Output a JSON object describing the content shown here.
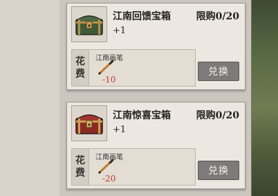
{
  "items": [
    {
      "name": "江南回馈宝箱",
      "qty": "+1",
      "limit": "限购0/20",
      "chest_color": "#3f5a3a",
      "cost_label": [
        "花",
        "费"
      ],
      "cost_item": "江南画笔",
      "cost_amount": "-10",
      "button": "兑换"
    },
    {
      "name": "江南惊喜宝箱",
      "qty": "+1",
      "limit": "限购0/20",
      "chest_color": "#8c2a24",
      "cost_label": [
        "花",
        "费"
      ],
      "cost_item": "江南画笔",
      "cost_amount": "-20",
      "button": "兑换"
    }
  ]
}
